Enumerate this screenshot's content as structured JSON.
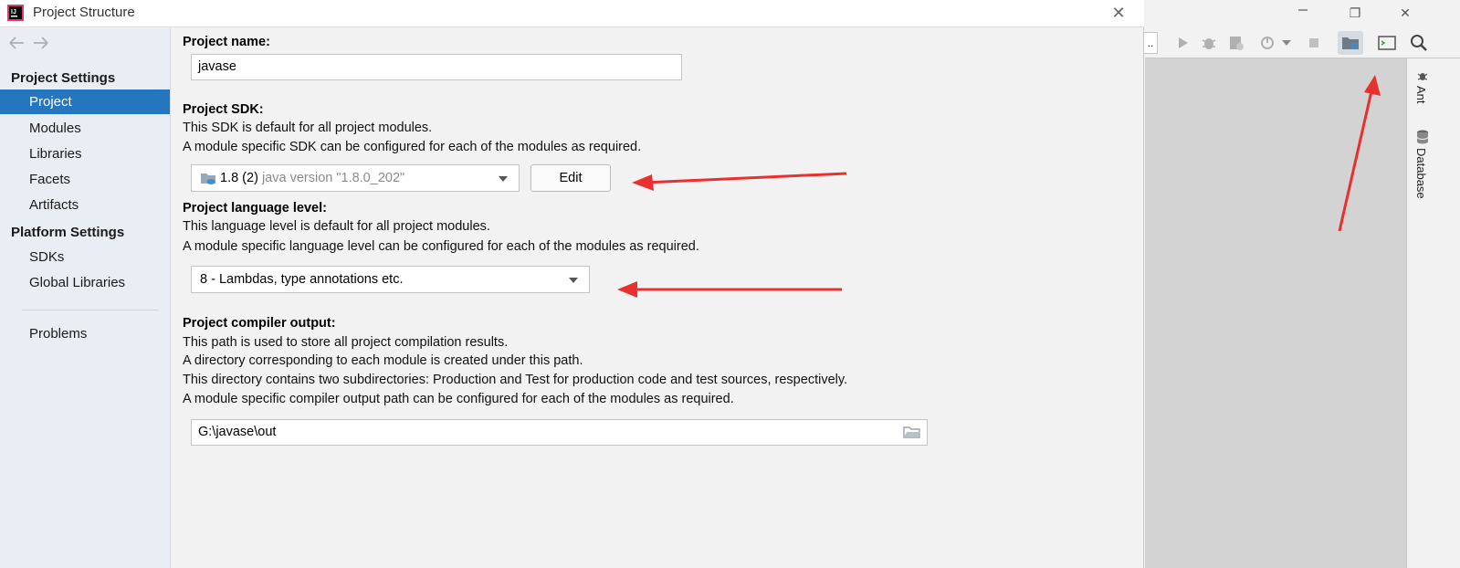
{
  "window": {
    "title": "Project Structure",
    "close_glyph": "✕"
  },
  "sidebar": {
    "project_settings_header": "Project Settings",
    "project_items": [
      {
        "label": "Project",
        "selected": true
      },
      {
        "label": "Modules"
      },
      {
        "label": "Libraries"
      },
      {
        "label": "Facets"
      },
      {
        "label": "Artifacts"
      }
    ],
    "platform_settings_header": "Platform Settings",
    "platform_items": [
      {
        "label": "SDKs"
      },
      {
        "label": "Global Libraries"
      }
    ],
    "problems_label": "Problems",
    "selected_color": "#2675bf"
  },
  "project_name": {
    "label": "Project name:",
    "value": "javase"
  },
  "project_sdk": {
    "label": "Project SDK:",
    "desc_line1": "This SDK is default for all project modules.",
    "desc_line2": "A module specific SDK can be configured for each of the modules as required.",
    "selected_name": "1.8 (2)",
    "selected_detail": "java version \"1.8.0_202\"",
    "edit_button": "Edit",
    "icon": "folder-cup-icon"
  },
  "language_level": {
    "label": "Project language level:",
    "desc_line1": "This language level is default for all project modules.",
    "desc_line2": "A module specific language level can be configured for each of the modules as required.",
    "selected": "8 - Lambdas, type annotations etc."
  },
  "compiler_output": {
    "label": "Project compiler output:",
    "desc_line1": "This path is used to store all project compilation results.",
    "desc_line2": "A directory corresponding to each module is created under this path.",
    "desc_line3": "This directory contains two subdirectories: Production and Test for production code and test sources, respectively.",
    "desc_line4": "A module specific compiler output path can be configured for each of the modules as required.",
    "path": "G:\\javase\\out"
  },
  "ide": {
    "toolbar_partial_label": "..",
    "side_tools": [
      "Ant",
      "Database"
    ],
    "restore_glyph": "❐",
    "close_glyph": "✕"
  },
  "annotation_color": "#e8312f"
}
